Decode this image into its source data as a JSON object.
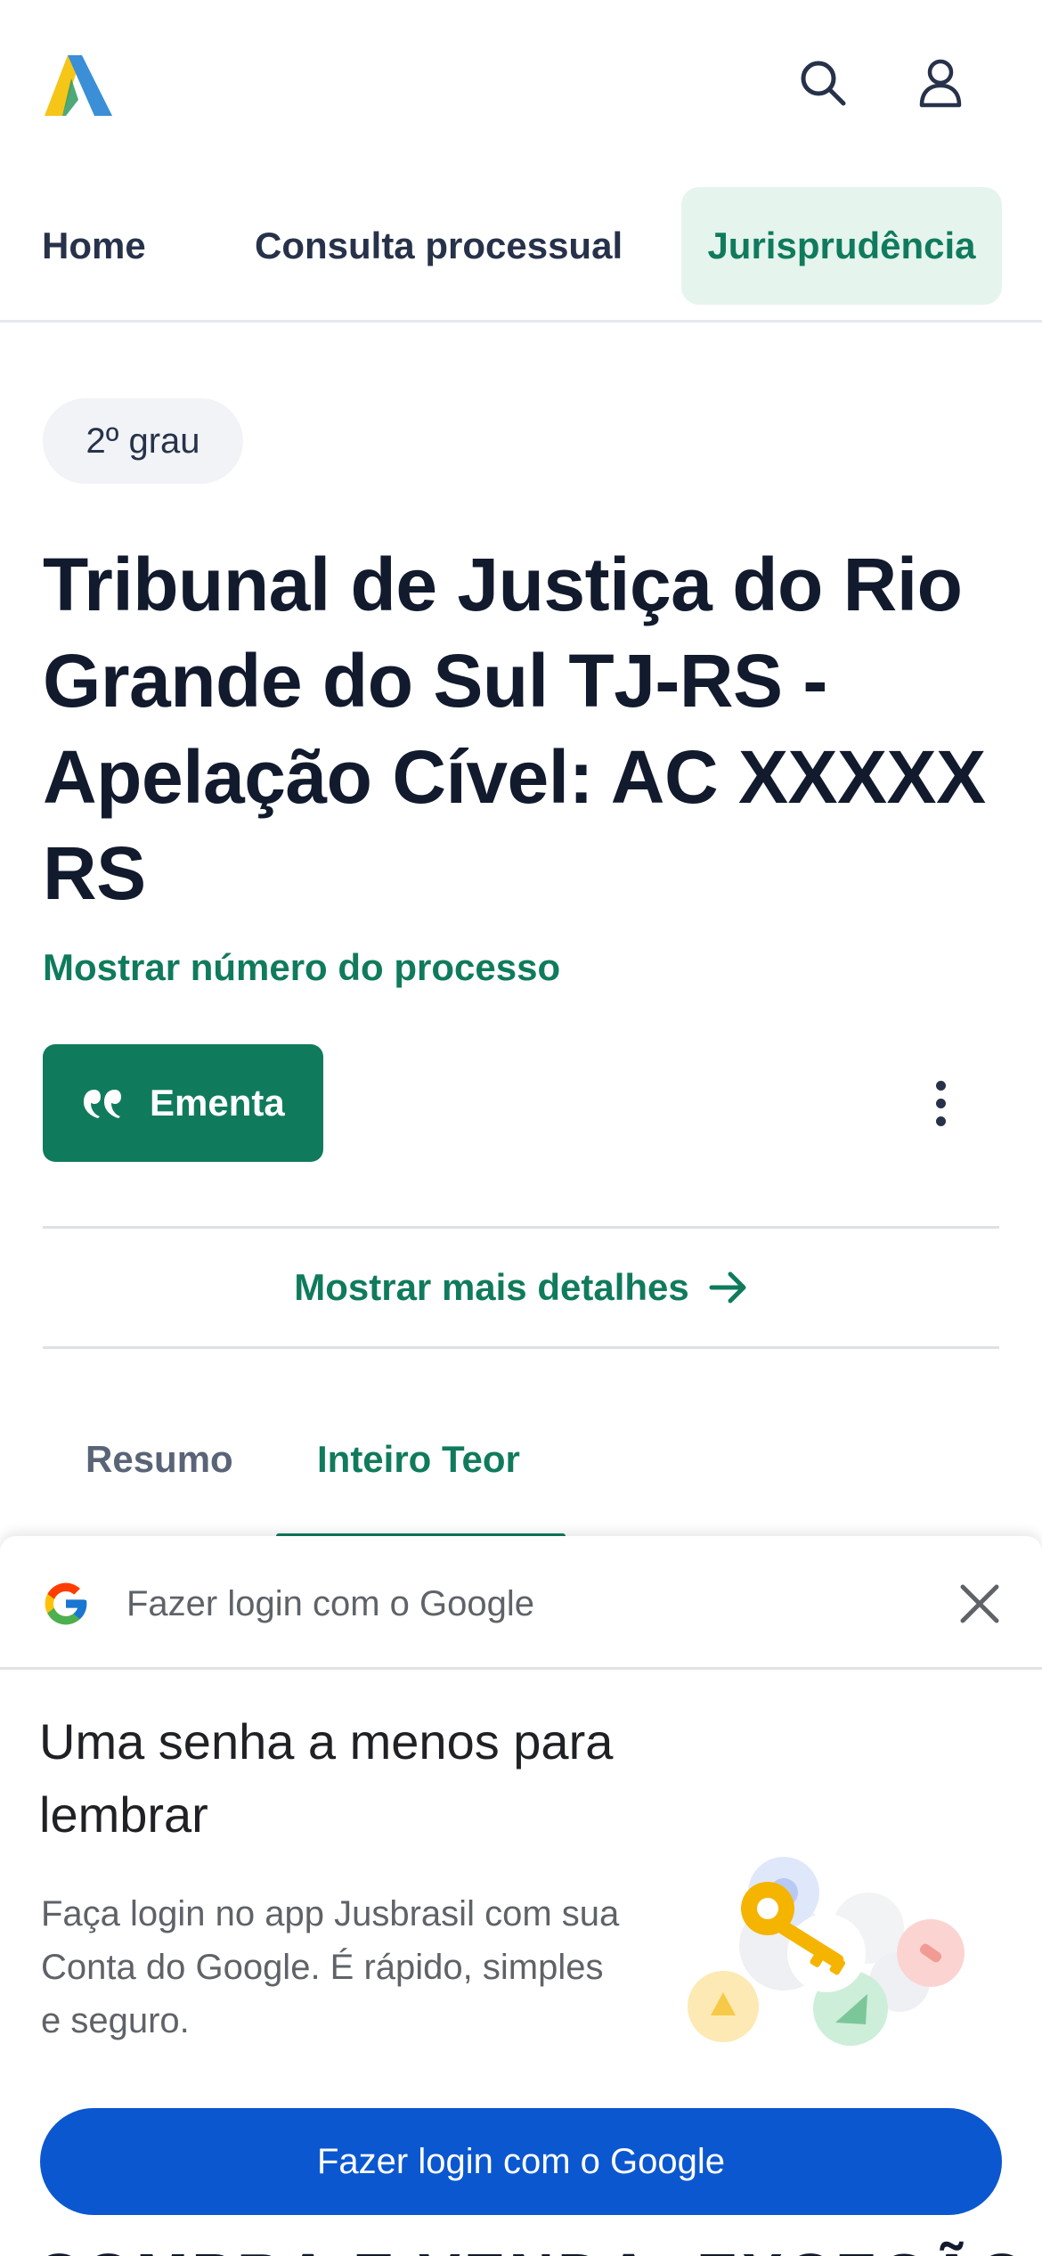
{
  "header": {
    "logo_icon": "jusbrasil-logo-icon",
    "search_icon": "search-icon",
    "user_icon": "user-icon"
  },
  "nav": {
    "items": [
      {
        "label": "Home",
        "active": false
      },
      {
        "label": "Consulta processual",
        "active": false
      },
      {
        "label": "Jurisprudência",
        "active": true
      }
    ]
  },
  "badge": "2º grau",
  "title": "Tribunal de Justiça do Rio Grande do Sul TJ-RS - Apelação Cível: AC XXXXX RS",
  "show_number_link": "Mostrar número do processo",
  "actions": {
    "ementa_label": "Ementa",
    "ementa_icon": "quote-icon",
    "more_icon": "more-vertical-icon"
  },
  "details_link": "Mostrar mais detalhes",
  "tabs": [
    {
      "label": "Resumo",
      "active": false
    },
    {
      "label": "Inteiro Teor",
      "active": true
    }
  ],
  "google_sheet": {
    "header_title": "Fazer login com o Google",
    "heading": "Uma senha a menos para lembrar",
    "body": "Faça login no app Jusbrasil com sua Conta do Google. É rápido, simples e seguro.",
    "button_label": "Fazer login com o Google",
    "close_icon": "close-icon",
    "illustration_icon": "key-icon"
  },
  "peek_text": "COMPRA E VENDA. EXCEÇÃO DE",
  "colors": {
    "brand_green": "#107b5c",
    "nav_active_bg": "#e6f4ee",
    "google_blue": "#0b57d0",
    "text_dark": "#121a2d"
  }
}
